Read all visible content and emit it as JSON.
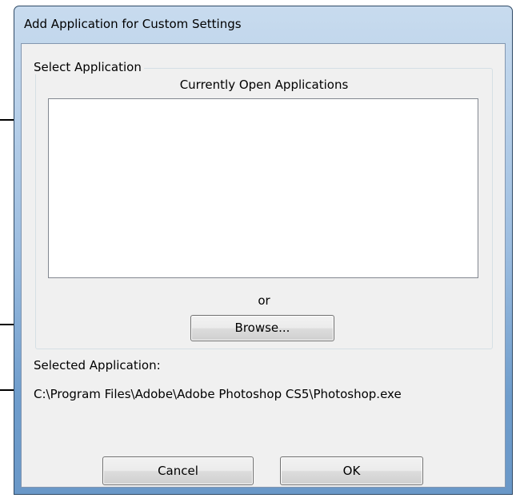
{
  "window": {
    "title": "Add Application for Custom Settings"
  },
  "select_group": {
    "label": "Select Application",
    "list_title": "Currently Open Applications",
    "items": [],
    "or_text": "or",
    "browse_label": "Browse..."
  },
  "selected": {
    "label": "Selected Application:",
    "path": "C:\\Program Files\\Adobe\\Adobe Photoshop CS5\\Photoshop.exe"
  },
  "footer": {
    "cancel_label": "Cancel",
    "ok_label": "OK"
  },
  "colors": {
    "frame": "#6f9dcc",
    "client_background": "#f0f0f0",
    "listbox_border": "#828790"
  }
}
